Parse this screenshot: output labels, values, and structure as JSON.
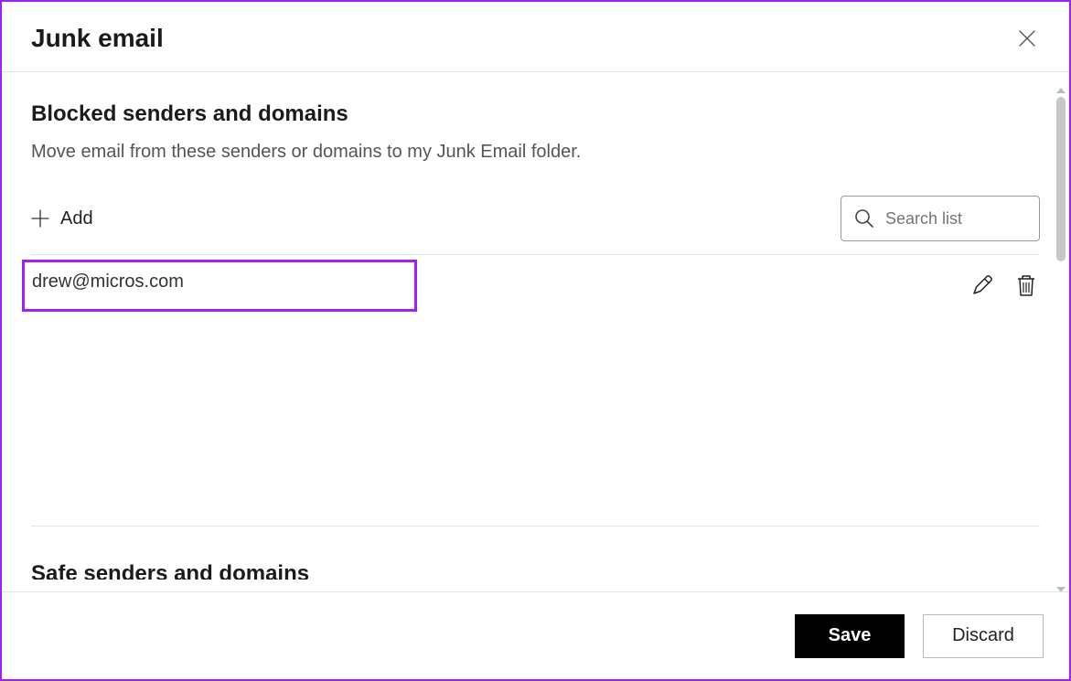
{
  "header": {
    "title": "Junk email"
  },
  "sections": {
    "blocked": {
      "title": "Blocked senders and domains",
      "description": "Move email from these senders or domains to my Junk Email folder.",
      "add_label": "Add",
      "search_placeholder": "Search list",
      "items": [
        {
          "email": "drew@micros.com"
        }
      ]
    },
    "safe": {
      "title": "Safe senders and domains"
    }
  },
  "footer": {
    "save_label": "Save",
    "discard_label": "Discard"
  },
  "colors": {
    "highlight_border": "#a020f0",
    "primary_button_bg": "#000000"
  }
}
